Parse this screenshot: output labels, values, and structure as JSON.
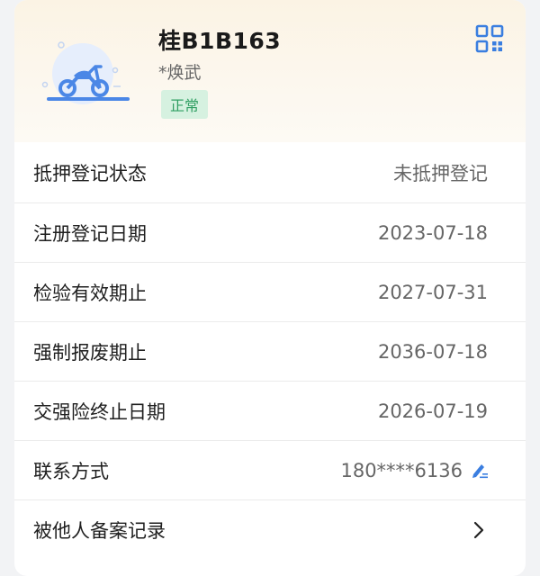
{
  "vehicle": {
    "plate": "桂B1B163",
    "owner": "*焕武",
    "status": "正常"
  },
  "icons": {
    "vehicle": "motorcycle-icon",
    "qr": "qrcode-icon",
    "edit": "edit-icon",
    "chevron": "chevron-right-icon"
  },
  "colors": {
    "accent": "#3a7ee0",
    "status_bg": "#d6f1e0",
    "status_text": "#2f9e62",
    "header_bg": "#fbf3e4"
  },
  "rows": [
    {
      "label": "抵押登记状态",
      "value": "未抵押登记"
    },
    {
      "label": "注册登记日期",
      "value": "2023-07-18"
    },
    {
      "label": "检验有效期止",
      "value": "2027-07-31"
    },
    {
      "label": "强制报废期止",
      "value": "2036-07-18"
    },
    {
      "label": "交强险终止日期",
      "value": "2026-07-19"
    },
    {
      "label": "联系方式",
      "value": "180****6136"
    },
    {
      "label": "被他人备案记录",
      "value": ""
    }
  ]
}
